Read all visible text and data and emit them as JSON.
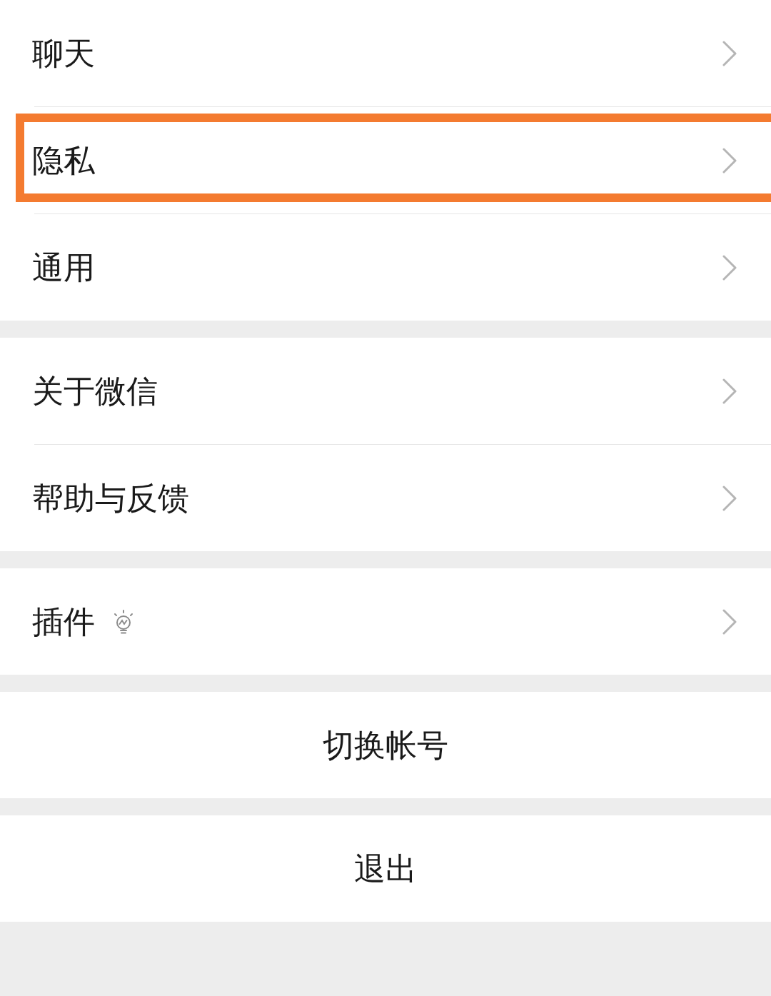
{
  "sections": [
    {
      "kind": "nav",
      "items": [
        {
          "label": "聊天",
          "highlighted": false,
          "hint_icon": false
        },
        {
          "label": "隐私",
          "highlighted": true,
          "hint_icon": false
        },
        {
          "label": "通用",
          "highlighted": false,
          "hint_icon": false
        }
      ]
    },
    {
      "kind": "nav",
      "items": [
        {
          "label": "关于微信",
          "highlighted": false,
          "hint_icon": false
        },
        {
          "label": "帮助与反馈",
          "highlighted": false,
          "hint_icon": false
        }
      ]
    },
    {
      "kind": "nav",
      "items": [
        {
          "label": "插件",
          "highlighted": false,
          "hint_icon": true
        }
      ]
    },
    {
      "kind": "action",
      "label": "切换帐号"
    },
    {
      "kind": "action",
      "label": "退出"
    }
  ]
}
